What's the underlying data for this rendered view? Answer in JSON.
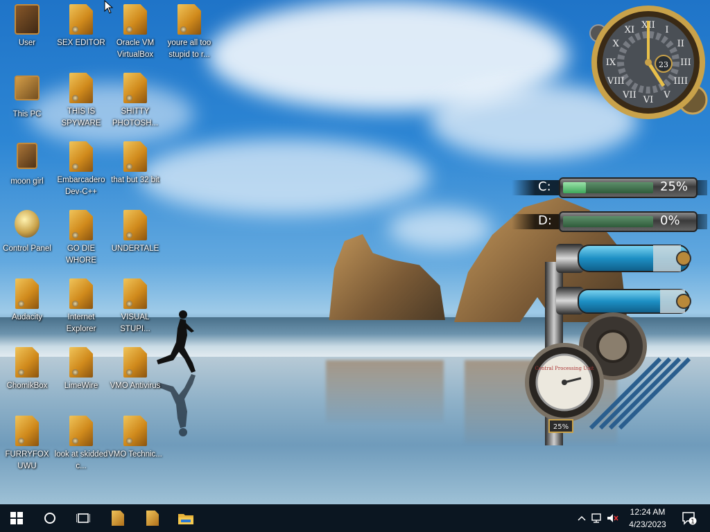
{
  "desktop_icons": [
    {
      "label": "User",
      "type": "folder-user"
    },
    {
      "label": "SEX EDITOR",
      "type": "file"
    },
    {
      "label": "Oracle VM VirtualBox",
      "type": "file"
    },
    {
      "label": "youre all too stupid to r...",
      "type": "file"
    },
    {
      "label": "This PC",
      "type": "computer"
    },
    {
      "label": "THIS IS SPYWARE",
      "type": "file"
    },
    {
      "label": "SHITTY PHOTOSH...",
      "type": "file"
    },
    {
      "label": "moon girl",
      "type": "box"
    },
    {
      "label": "Embarcadero Dev-C++",
      "type": "file"
    },
    {
      "label": "that but 32 bit",
      "type": "file"
    },
    {
      "label": "Control Panel",
      "type": "bulb"
    },
    {
      "label": "GO DIE WHORE",
      "type": "file"
    },
    {
      "label": "UNDERTALE",
      "type": "file"
    },
    {
      "label": "Audacity",
      "type": "file"
    },
    {
      "label": "Internet Explorer",
      "type": "file"
    },
    {
      "label": "VISUAL STUPI...",
      "type": "file"
    },
    {
      "label": "ChomikBox",
      "type": "file"
    },
    {
      "label": "LimeWire",
      "type": "file"
    },
    {
      "label": "VMO Antivirus",
      "type": "file"
    },
    {
      "label": "FURRYFOX UWU",
      "type": "file"
    },
    {
      "label": "look at skidded c...",
      "type": "file"
    },
    {
      "label": "VMO Technic..."
    }
  ],
  "clock": {
    "day": "23",
    "numerals": [
      "XII",
      "I",
      "II",
      "III",
      "IIII",
      "V",
      "VI",
      "VII",
      "VIII",
      "IX",
      "X",
      "XI"
    ]
  },
  "drives": [
    {
      "letter": "C:",
      "percent_label": "25%",
      "fill": 0.25
    },
    {
      "letter": "D:",
      "percent_label": "0%",
      "fill": 0.0
    }
  ],
  "gauge": {
    "title": "Central Processing Unit",
    "value_label": "25%"
  },
  "taskbar": {
    "start_icon": "windows-logo-icon",
    "search_icon": "search-circle-icon",
    "taskview_icon": "task-view-icon",
    "pinned": [
      "file-icon",
      "file-icon",
      "file-explorer-icon"
    ],
    "time": "12:24 AM",
    "date": "4/23/2023",
    "notification_count": "1"
  },
  "colors": {
    "taskbar": "#0b1621",
    "accent": "#2b7ad6",
    "meter_green": "#3ea85b"
  }
}
